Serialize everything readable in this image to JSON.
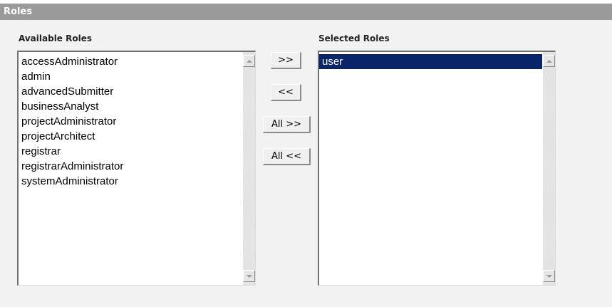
{
  "panel": {
    "title": "Roles"
  },
  "available": {
    "label": "Available Roles",
    "items": [
      "accessAdministrator",
      "admin",
      "advancedSubmitter",
      "businessAnalyst",
      "projectAdministrator",
      "projectArchitect",
      "registrar",
      "registrarAdministrator",
      "systemAdministrator"
    ]
  },
  "selected": {
    "label": "Selected Roles",
    "items": [
      "user"
    ],
    "highlighted_index": 0
  },
  "buttons": {
    "add": ">>",
    "remove": "<<",
    "add_all": "All >>",
    "remove_all": "All <<"
  },
  "colors": {
    "header_bg": "#9a9a9a",
    "panel_bg": "#f2f2f2",
    "selection_bg": "#0a246a"
  }
}
